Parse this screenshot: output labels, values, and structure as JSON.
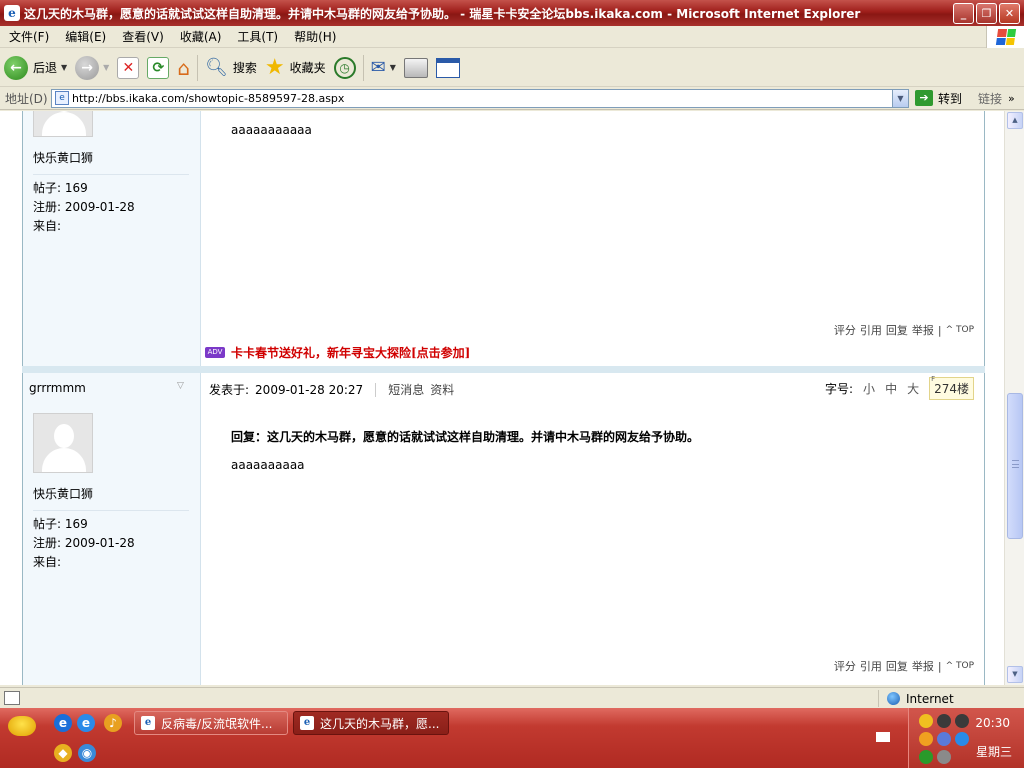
{
  "window": {
    "title": "这几天的木马群，愿意的话就试试这样自助清理。并请中木马群的网友给予协助。 - 瑞星卡卡安全论坛bbs.ikaka.com - Microsoft Internet Explorer",
    "minimize": "_",
    "maximize": "❐",
    "close": "✕"
  },
  "menu": [
    "文件(F)",
    "编辑(E)",
    "查看(V)",
    "收藏(A)",
    "工具(T)",
    "帮助(H)"
  ],
  "toolbar": {
    "back_label": "后退",
    "search_label": "搜索",
    "favorites_label": "收藏夹"
  },
  "address": {
    "label": "地址(D)",
    "url": "http://bbs.ikaka.com/showtopic-8589597-28.aspx",
    "go_label": "转到",
    "links_label": "链接"
  },
  "post1": {
    "username": "快乐黄口狮",
    "posts": "帖子: 169",
    "registered": "注册:  2009-01-28",
    "from": "来自:",
    "message": "aaaaaaaaaaa",
    "actions": [
      "评分",
      "引用",
      "回复",
      "举报"
    ],
    "top_label": "TOP",
    "ad_icon": "ADV",
    "ad_text": "卡卡春节送好礼，新年寻宝大探险[点击参加]"
  },
  "post2": {
    "author": "grrrmmm",
    "posted_label": "发表于:",
    "posted_time": "2009-01-28 20:27",
    "pm_label": "短消息",
    "profile_label": "资料",
    "fontsize_label": "字号:",
    "fontsize_small": "小",
    "fontsize_mid": "中",
    "fontsize_large": "大",
    "floor": "274楼",
    "reply_title": "回复：这几天的木马群，愿意的话就试试这样自助清理。并请中木马群的网友给予协助。",
    "message": "aaaaaaaaaa",
    "username": "快乐黄口狮",
    "posts": "帖子: 169",
    "registered": "注册:  2009-01-28",
    "from": "来自:",
    "actions": [
      "评分",
      "引用",
      "回复",
      "举报"
    ],
    "top_label": "TOP"
  },
  "statusbar": {
    "zone": "Internet"
  },
  "taskbar": {
    "tasks": [
      {
        "label": "反病毒/反流氓软件...",
        "active": false
      },
      {
        "label": "这几天的木马群，愿...",
        "active": true
      }
    ],
    "clock": "20:30",
    "day": "星期三"
  }
}
